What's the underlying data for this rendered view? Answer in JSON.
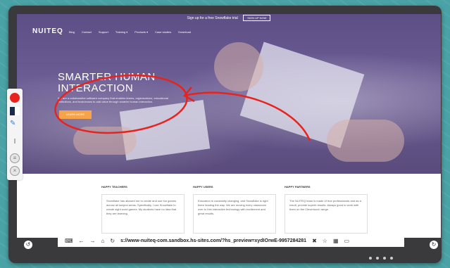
{
  "banner": {
    "text": "Sign up for a free Snowflake trial",
    "button": "SIGN UP NOW"
  },
  "nav": {
    "logo": "NUITEQ",
    "items": [
      "Blog",
      "Contact",
      "Support",
      "Training ▾",
      "Products ▾",
      "Case studies",
      "Download"
    ]
  },
  "hero": {
    "title": "SMARTER HUMAN INTERACTION",
    "description": "We are a collaborative software company that enables teams, organizations, educational institutions, and businesses to add value through smarter human interaction.",
    "button": "LEARN MORE"
  },
  "columns": [
    {
      "title": "HAPPY TEACHERS",
      "text": "Snowflake has allowed me to create and use fun games across all subject areas. Specifically, I use Snowflake to create sight word games. My students have no idea that they are learning."
    },
    {
      "title": "HAPPY USERS",
      "text": "Education is constantly changing, and Snowflake is right there leading the way. We are moving every classroom over to this interactive technology with excitement and great results."
    },
    {
      "title": "HAPPY PARTNERS",
      "text": "The NUITEQ team is made of true professionals and as a result, provide superb results. Always good to work with them on the Clevertouch range."
    }
  ],
  "address_bar": {
    "url": "s://www-nuiteq-com.sandbox.hs-sites.com/?hs_preview=xydIOrwE-9957284281"
  },
  "annotation": {
    "color": "#e8231d"
  },
  "icons": {
    "back": "←",
    "forward": "→",
    "home": "⌂",
    "reload": "↻",
    "close": "✖",
    "star": "☆",
    "grid": "▦",
    "window": "▭"
  }
}
